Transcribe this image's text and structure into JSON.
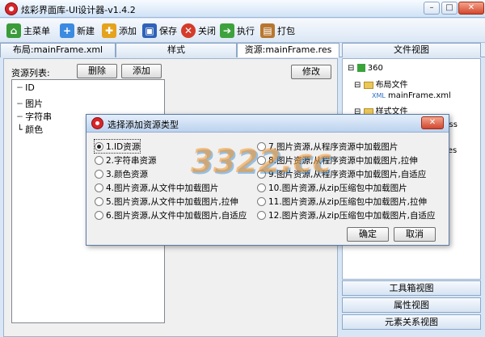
{
  "app": {
    "title": "炫彩界面库-UI设计器-v1.4.2"
  },
  "window_buttons": {
    "minimize": "–",
    "maximize": "□",
    "close": "✕"
  },
  "toolbar": {
    "items": [
      {
        "label": "主菜单",
        "icon": "home-icon",
        "color": "#3a9b3a"
      },
      {
        "label": "新建",
        "icon": "new-file-icon",
        "color": "#3c8be0"
      },
      {
        "label": "添加",
        "icon": "add-icon",
        "color": "#e5a21c"
      },
      {
        "label": "保存",
        "icon": "save-icon",
        "color": "#2f62b8"
      },
      {
        "label": "关闭",
        "icon": "close-icon",
        "color": "#d43b2a"
      },
      {
        "label": "执行",
        "icon": "run-icon",
        "color": "#3da23d"
      },
      {
        "label": "打包",
        "icon": "package-icon",
        "color": "#b87730"
      }
    ]
  },
  "tabs": [
    "布局:mainFrame.xml",
    "样式",
    "资源:mainFrame.res",
    "文件视图"
  ],
  "resources": {
    "list_label": "资源列表:",
    "delete_label": "删除",
    "add_label": "添加",
    "edit_label": "修改",
    "items": [
      "ID",
      "图片",
      "字符串",
      "颜色"
    ]
  },
  "file_tree": {
    "root": "360",
    "nodes": [
      "布局文件",
      "mainFrame.xml",
      "样式文件",
      "css",
      "res"
    ]
  },
  "side_panels": [
    "工具箱视图",
    "属性视图",
    "元素关系视图"
  ],
  "dialog": {
    "title": "选择添加资源类型",
    "options_left": [
      "1.ID资源",
      "2.字符串资源",
      "3.颜色资源",
      "4.图片资源,从文件中加载图片",
      "5.图片资源,从文件中加载图片,拉伸",
      "6.图片资源,从文件中加载图片,自适应"
    ],
    "options_right": [
      "7.图片资源,从程序资源中加载图片",
      "8.图片资源,从程序资源中加载图片,拉伸",
      "9.图片资源,从程序资源中加载图片,自适应",
      "10.图片资源,从zip压缩包中加载图片",
      "11.图片资源,从zip压缩包中加载图片,拉伸",
      "12.图片资源,从zip压缩包中加载图片,自适应"
    ],
    "selected": "1.ID资源",
    "ok_label": "确定",
    "cancel_label": "取消"
  },
  "watermark": "3322.cc"
}
